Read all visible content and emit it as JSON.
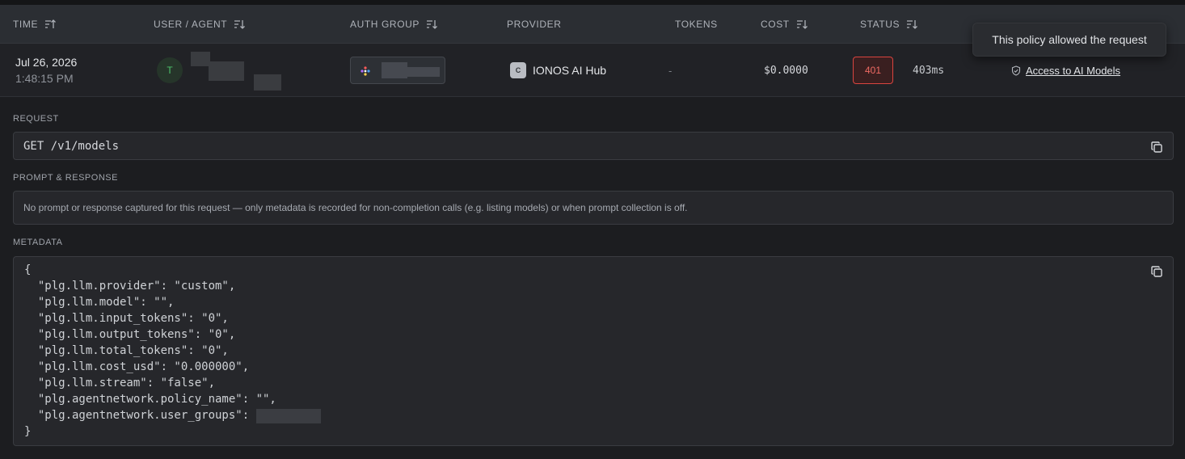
{
  "table": {
    "headers": {
      "time": "TIME",
      "user_agent": "USER / AGENT",
      "auth_group": "AUTH GROUP",
      "provider": "PROVIDER",
      "tokens": "TOKENS",
      "cost": "COST",
      "status": "STATUS"
    },
    "row": {
      "date": "Jul 26, 2026",
      "clock": "1:48:15 PM",
      "avatar_initial": "T",
      "provider_icon_letter": "C",
      "provider": "IONOS AI Hub",
      "tokens": "-",
      "cost": "$0.0000",
      "status_code": "401",
      "latency": "403ms",
      "reason": "Access to AI Models"
    }
  },
  "tooltip": {
    "text": "This policy allowed the request"
  },
  "request": {
    "label": "REQUEST",
    "value": "GET /v1/models"
  },
  "prompt": {
    "label": "PROMPT & RESPONSE",
    "text": "No prompt or response captured for this request — only metadata is recorded for non-completion calls (e.g. listing models) or when prompt collection is off."
  },
  "metadata": {
    "label": "METADATA",
    "lines": [
      "{",
      "  \"plg.llm.provider\": \"custom\",",
      "  \"plg.llm.model\": \"\",",
      "  \"plg.llm.input_tokens\": \"0\",",
      "  \"plg.llm.output_tokens\": \"0\",",
      "  \"plg.llm.total_tokens\": \"0\",",
      "  \"plg.llm.cost_usd\": \"0.000000\",",
      "  \"plg.llm.stream\": \"false\",",
      "  \"plg.agentnetwork.policy_name\": \"\",",
      "  \"plg.agentnetwork.user_groups\": ",
      "}"
    ]
  },
  "colors": {
    "background": "#1c1d20",
    "header": "#2b2e33",
    "status_error": "#d9443f",
    "avatar_green": "#4dc36b"
  },
  "icons": [
    "sort-desc-icon",
    "sort-asc-icon",
    "copy-icon",
    "shield-check-icon",
    "provider-icon",
    "auth-group-logo-icon"
  ]
}
